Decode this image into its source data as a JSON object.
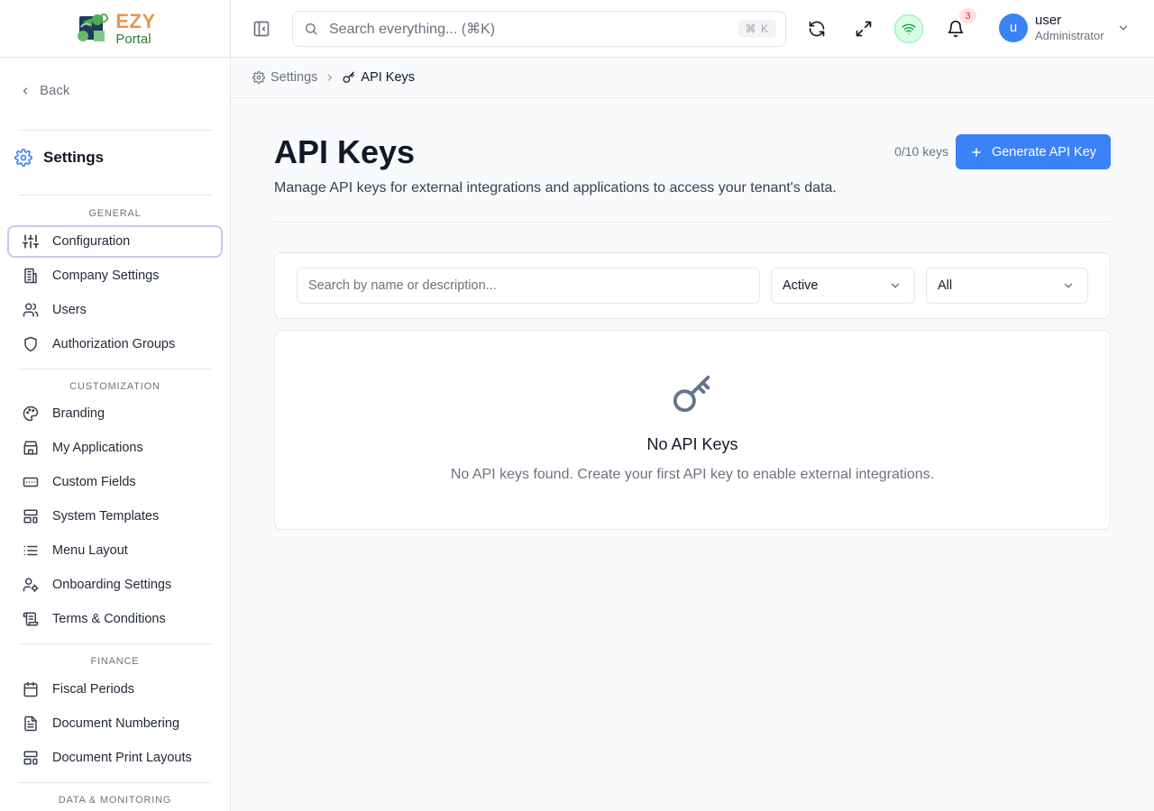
{
  "brand": {
    "name_top": "EZY",
    "name_bottom": "Portal"
  },
  "sidebar": {
    "back_label": "Back",
    "title": "Settings",
    "sections": {
      "general": "GENERAL",
      "customization": "CUSTOMIZATION",
      "finance": "FINANCE",
      "data_monitoring": "DATA & MONITORING"
    },
    "items": [
      {
        "label": "Configuration",
        "icon": "sliders-icon",
        "active": true
      },
      {
        "label": "Company Settings",
        "icon": "building-icon"
      },
      {
        "label": "Users",
        "icon": "users-icon"
      },
      {
        "label": "Authorization Groups",
        "icon": "shield-icon"
      },
      {
        "label": "Branding",
        "icon": "palette-icon"
      },
      {
        "label": "My Applications",
        "icon": "store-icon"
      },
      {
        "label": "Custom Fields",
        "icon": "input-field-icon"
      },
      {
        "label": "System Templates",
        "icon": "layout-template-icon"
      },
      {
        "label": "Menu Layout",
        "icon": "list-icon"
      },
      {
        "label": "Onboarding Settings",
        "icon": "user-cog-icon"
      },
      {
        "label": "Terms & Conditions",
        "icon": "scroll-icon"
      },
      {
        "label": "Fiscal Periods",
        "icon": "calendar-icon"
      },
      {
        "label": "Document Numbering",
        "icon": "file-text-icon"
      },
      {
        "label": "Document Print Layouts",
        "icon": "layout-template-icon"
      }
    ]
  },
  "topbar": {
    "search_placeholder": "Search everything... (⌘K)",
    "search_shortcut": "⌘ K",
    "notification_count": "3",
    "user": {
      "initial": "u",
      "name": "user",
      "role": "Administrator"
    }
  },
  "breadcrumb": {
    "parent": "Settings",
    "current": "API Keys"
  },
  "main": {
    "title": "API Keys",
    "description": "Manage API keys for external integrations and applications to access your tenant's data.",
    "key_count": "0/10 keys",
    "generate_label": "Generate API Key",
    "filters": {
      "search_placeholder": "Search by name or description...",
      "status_value": "Active",
      "type_value": "All"
    },
    "empty": {
      "title": "No API Keys",
      "description": "No API keys found. Create your first API key to enable external integrations."
    }
  },
  "colors": {
    "accent": "#3b82f6",
    "brand_orange": "#e8954a",
    "brand_green": "#2e7d32",
    "online": "#16a34a"
  }
}
